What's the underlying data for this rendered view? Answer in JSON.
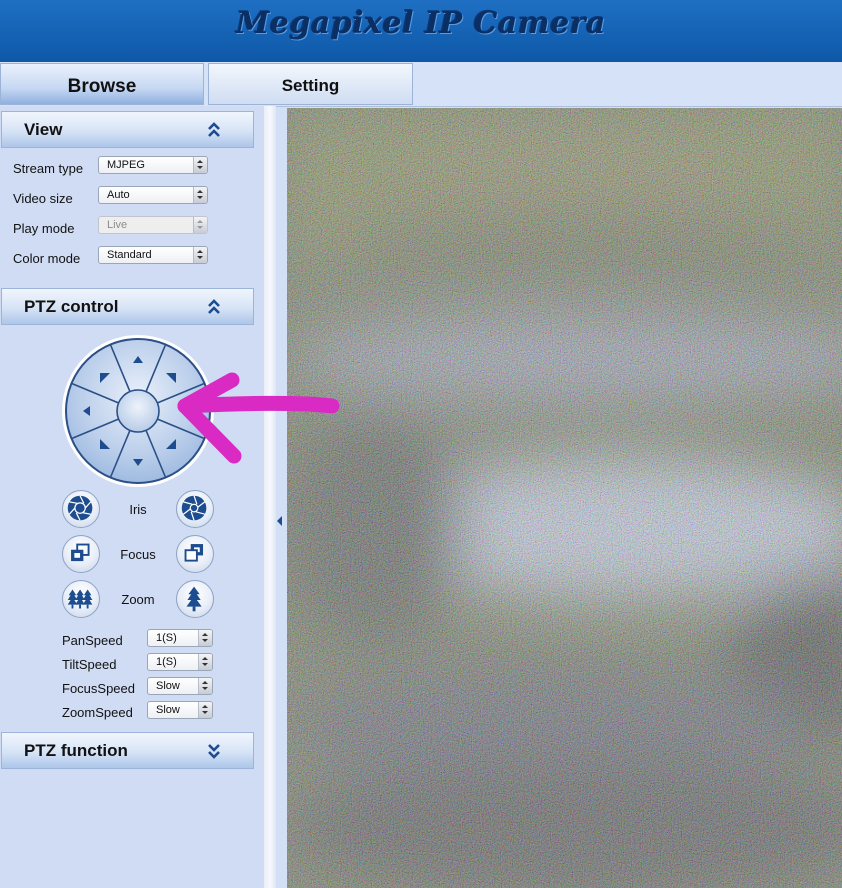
{
  "header": {
    "title": "Megapixel IP Camera"
  },
  "tabs": {
    "browse": "Browse",
    "setting": "Setting"
  },
  "view_panel": {
    "title": "View",
    "rows": [
      {
        "label": "Stream type",
        "value": "MJPEG",
        "disabled": false
      },
      {
        "label": "Video size",
        "value": "Auto",
        "disabled": false
      },
      {
        "label": "Play mode",
        "value": "Live",
        "disabled": true
      },
      {
        "label": "Color mode",
        "value": "Standard",
        "disabled": false
      }
    ]
  },
  "ptz_panel": {
    "title": "PTZ control",
    "iris_label": "Iris",
    "focus_label": "Focus",
    "zoom_label": "Zoom",
    "speeds": [
      {
        "label": "PanSpeed",
        "value": "1(S)"
      },
      {
        "label": "TiltSpeed",
        "value": "1(S)"
      },
      {
        "label": "FocusSpeed",
        "value": "Slow"
      },
      {
        "label": "ZoomSpeed",
        "value": "Slow"
      }
    ]
  },
  "ptz_function_panel": {
    "title": "PTZ function"
  },
  "colors": {
    "header_bg": "#1565b8",
    "title_text": "#0b2f63",
    "sidebar_bg": "#cfdcf3",
    "arrow_accent": "#1d4d8f",
    "annotation": "#d92bc4"
  },
  "icons": {
    "collapse": "double-chevron-up-icon",
    "expand": "double-chevron-down-icon",
    "iris_open": "aperture-icon",
    "iris_close": "aperture-icon",
    "focus_near": "focus-squares-icon",
    "focus_far": "focus-squares-icon",
    "zoom_out": "trees-icon",
    "zoom_in": "tree-icon"
  }
}
